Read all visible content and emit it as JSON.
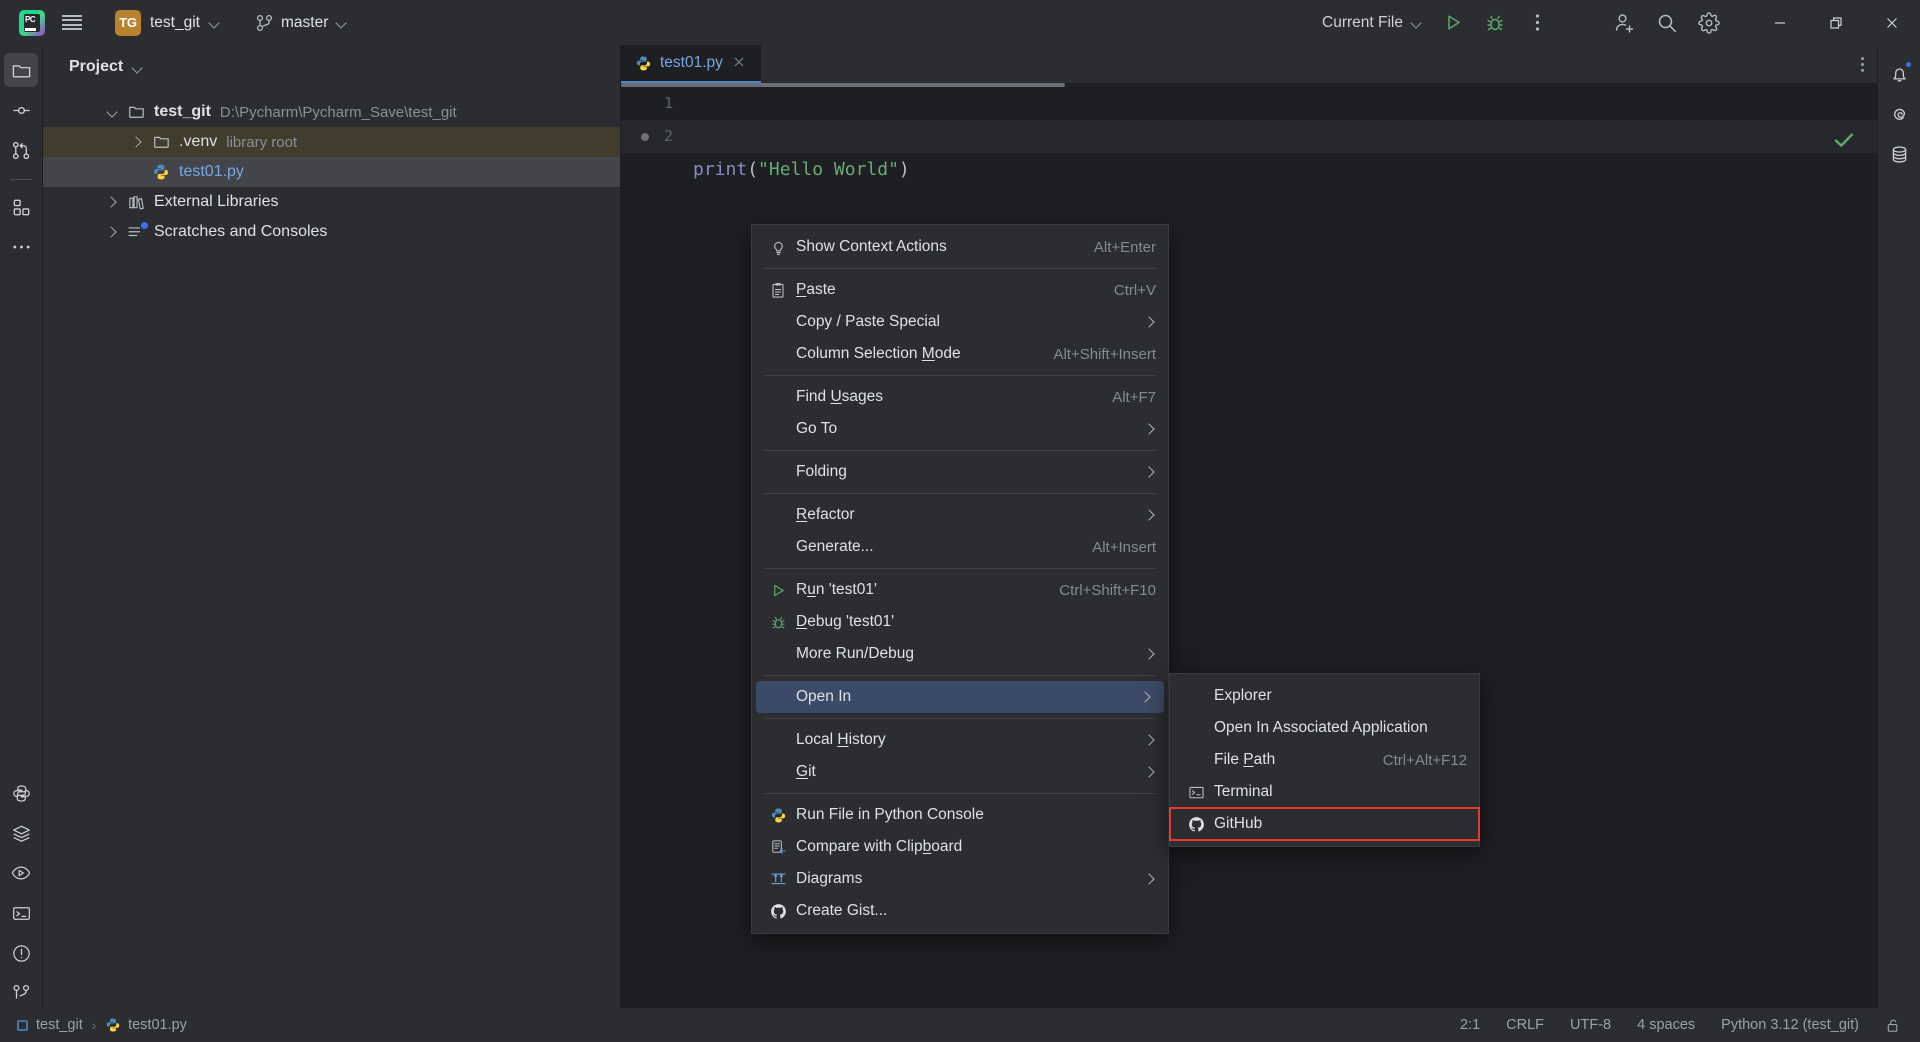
{
  "titlebar": {
    "menu_icon": "hamburger-icon",
    "project_badge": "TG",
    "project_name": "test_git",
    "branch_icon": "git-branch-icon",
    "branch_name": "master",
    "run_config": "Current File",
    "run_icon": "run-icon",
    "debug_icon": "debug-icon",
    "more_icon": "more-vertical-icon",
    "account_icon": "add-account-icon",
    "search_icon": "search-icon",
    "settings_icon": "gear-icon",
    "minimize_icon": "minimize-icon",
    "maximize_icon": "maximize-icon",
    "close_icon": "close-icon"
  },
  "left_toolbar": {
    "items": [
      {
        "name": "project-tool-window",
        "icon": "folder-icon",
        "active": true
      },
      {
        "name": "commit-tool-window",
        "icon": "commit-icon",
        "active": false
      },
      {
        "name": "pull-requests-tool-window",
        "icon": "git-pull-request-icon",
        "active": false
      },
      {
        "name": "plugins-tool-window",
        "icon": "blocks-icon",
        "active": false
      },
      {
        "name": "more-tool-windows",
        "icon": "more-horizontal-icon",
        "active": false
      }
    ],
    "bottom_items": [
      {
        "name": "python-packages",
        "icon": "python-icon"
      },
      {
        "name": "database-layers",
        "icon": "layers-icon"
      },
      {
        "name": "run-tool-window",
        "icon": "run-panel-icon"
      },
      {
        "name": "terminal-tool-window",
        "icon": "terminal-icon"
      },
      {
        "name": "problems-tool-window",
        "icon": "warning-circle-icon"
      },
      {
        "name": "version-control-tool-window",
        "icon": "git-branch-icon"
      }
    ]
  },
  "right_toolbar": {
    "items": [
      {
        "name": "notifications",
        "icon": "bell-icon",
        "badge": true
      },
      {
        "name": "ai-assistant",
        "icon": "spiral-icon",
        "badge": false
      },
      {
        "name": "database",
        "icon": "database-icon",
        "badge": false
      }
    ]
  },
  "project_panel": {
    "title": "Project",
    "title_chevron": "chevron-down-icon",
    "tree": [
      {
        "label": "test_git",
        "sub": "D:\\Pycharm\\Pycharm_Save\\test_git",
        "icon": "folder-icon",
        "arrow": "down",
        "indent": 0,
        "bold": true,
        "state": "normal"
      },
      {
        "label": ".venv",
        "sub": "library root",
        "icon": "folder-icon",
        "arrow": "right",
        "indent": 1,
        "bold": false,
        "state": "venv-highlight"
      },
      {
        "label": "test01.py",
        "sub": "",
        "icon": "python-file-icon",
        "arrow": "none",
        "indent": 1,
        "bold": false,
        "state": "selected"
      },
      {
        "label": "External Libraries",
        "sub": "",
        "icon": "library-icon",
        "arrow": "right",
        "indent": 0,
        "bold": false,
        "state": "normal"
      },
      {
        "label": "Scratches and Consoles",
        "sub": "",
        "icon": "scratches-icon",
        "arrow": "right",
        "indent": 0,
        "bold": false,
        "state": "normal"
      }
    ]
  },
  "editor": {
    "tab": {
      "label": "test01.py",
      "icon": "python-file-icon",
      "close_icon": "close-icon"
    },
    "options_icon": "more-vertical-icon",
    "inspection_icon": "checkmark-icon",
    "lines": [
      {
        "number": "1",
        "segments": [
          {
            "text": "print",
            "class": "kw-func"
          },
          {
            "text": "(",
            "class": "punct"
          },
          {
            "text": "\"Hello World\"",
            "class": "str"
          },
          {
            "text": ")",
            "class": "punct"
          }
        ]
      },
      {
        "number": "2",
        "segments": []
      }
    ],
    "code_text": "print(\"Hello World\")"
  },
  "context_menu": {
    "groups": [
      [
        {
          "label": "Show Context Actions",
          "shortcut": "Alt+Enter",
          "icon": "lightbulb-icon",
          "arrow": false,
          "mnemonic": ""
        }
      ],
      [
        {
          "label": "Paste",
          "shortcut": "Ctrl+V",
          "icon": "clipboard-icon",
          "arrow": false,
          "mnemonic": "P"
        },
        {
          "label": "Copy / Paste Special",
          "shortcut": "",
          "icon": "",
          "arrow": true,
          "mnemonic": ""
        },
        {
          "label": "Column Selection Mode",
          "shortcut": "Alt+Shift+Insert",
          "icon": "",
          "arrow": false,
          "mnemonic": "M"
        }
      ],
      [
        {
          "label": "Find Usages",
          "shortcut": "Alt+F7",
          "icon": "",
          "arrow": false,
          "mnemonic": "U"
        },
        {
          "label": "Go To",
          "shortcut": "",
          "icon": "",
          "arrow": true,
          "mnemonic": ""
        }
      ],
      [
        {
          "label": "Folding",
          "shortcut": "",
          "icon": "",
          "arrow": true,
          "mnemonic": ""
        }
      ],
      [
        {
          "label": "Refactor",
          "shortcut": "",
          "icon": "",
          "arrow": true,
          "mnemonic": "R"
        },
        {
          "label": "Generate...",
          "shortcut": "Alt+Insert",
          "icon": "",
          "arrow": false,
          "mnemonic": ""
        }
      ],
      [
        {
          "label": "Run 'test01'",
          "shortcut": "Ctrl+Shift+F10",
          "icon": "run-icon",
          "arrow": false,
          "mnemonic": "u"
        },
        {
          "label": "Debug 'test01'",
          "shortcut": "",
          "icon": "debug-icon",
          "arrow": false,
          "mnemonic": "D"
        },
        {
          "label": "More Run/Debug",
          "shortcut": "",
          "icon": "",
          "arrow": true,
          "mnemonic": ""
        }
      ],
      [
        {
          "label": "Open In",
          "shortcut": "",
          "icon": "",
          "arrow": true,
          "mnemonic": "",
          "selected": true
        }
      ],
      [
        {
          "label": "Local History",
          "shortcut": "",
          "icon": "",
          "arrow": true,
          "mnemonic": "H"
        },
        {
          "label": "Git",
          "shortcut": "",
          "icon": "",
          "arrow": true,
          "mnemonic": "G"
        }
      ],
      [
        {
          "label": "Run File in Python Console",
          "shortcut": "",
          "icon": "python-icon",
          "arrow": false,
          "mnemonic": ""
        },
        {
          "label": "Compare with Clipboard",
          "shortcut": "",
          "icon": "compare-icon",
          "arrow": false,
          "mnemonic": "o"
        },
        {
          "label": "Diagrams",
          "shortcut": "",
          "icon": "diagram-icon",
          "arrow": true,
          "mnemonic": ""
        },
        {
          "label": "Create Gist...",
          "shortcut": "",
          "icon": "github-icon",
          "arrow": false,
          "mnemonic": ""
        }
      ]
    ]
  },
  "submenu": {
    "items": [
      {
        "label": "Explorer",
        "shortcut": "",
        "icon": "",
        "highlighted": false
      },
      {
        "label": "Open In Associated Application",
        "shortcut": "",
        "icon": "",
        "highlighted": false
      },
      {
        "label": "File Path",
        "shortcut": "Ctrl+Alt+F12",
        "icon": "",
        "highlighted": false,
        "mnemonic": "P"
      },
      {
        "label": "Terminal",
        "shortcut": "",
        "icon": "terminal-icon",
        "highlighted": false
      },
      {
        "label": "GitHub",
        "shortcut": "",
        "icon": "github-icon",
        "highlighted": true
      }
    ]
  },
  "statusbar": {
    "breadcrumbs": [
      {
        "label": "test_git",
        "icon": "module-icon"
      },
      {
        "label": "test01.py",
        "icon": "python-file-icon"
      }
    ],
    "separator": "›",
    "position": "2:1",
    "line_separator": "CRLF",
    "encoding": "UTF-8",
    "indent": "4 spaces",
    "interpreter": "Python 3.12 (test_git)",
    "lock_icon": "unlocked-icon"
  },
  "colors": {
    "bg": "#2b2d30",
    "editor_bg": "#1e1f22",
    "accent_blue": "#4a88c7",
    "selection": "#3b4a66",
    "highlight_ring": "#e33c2e",
    "venv_highlight": "#413c2b",
    "green": "#59a869",
    "string_green": "#6aab73"
  }
}
